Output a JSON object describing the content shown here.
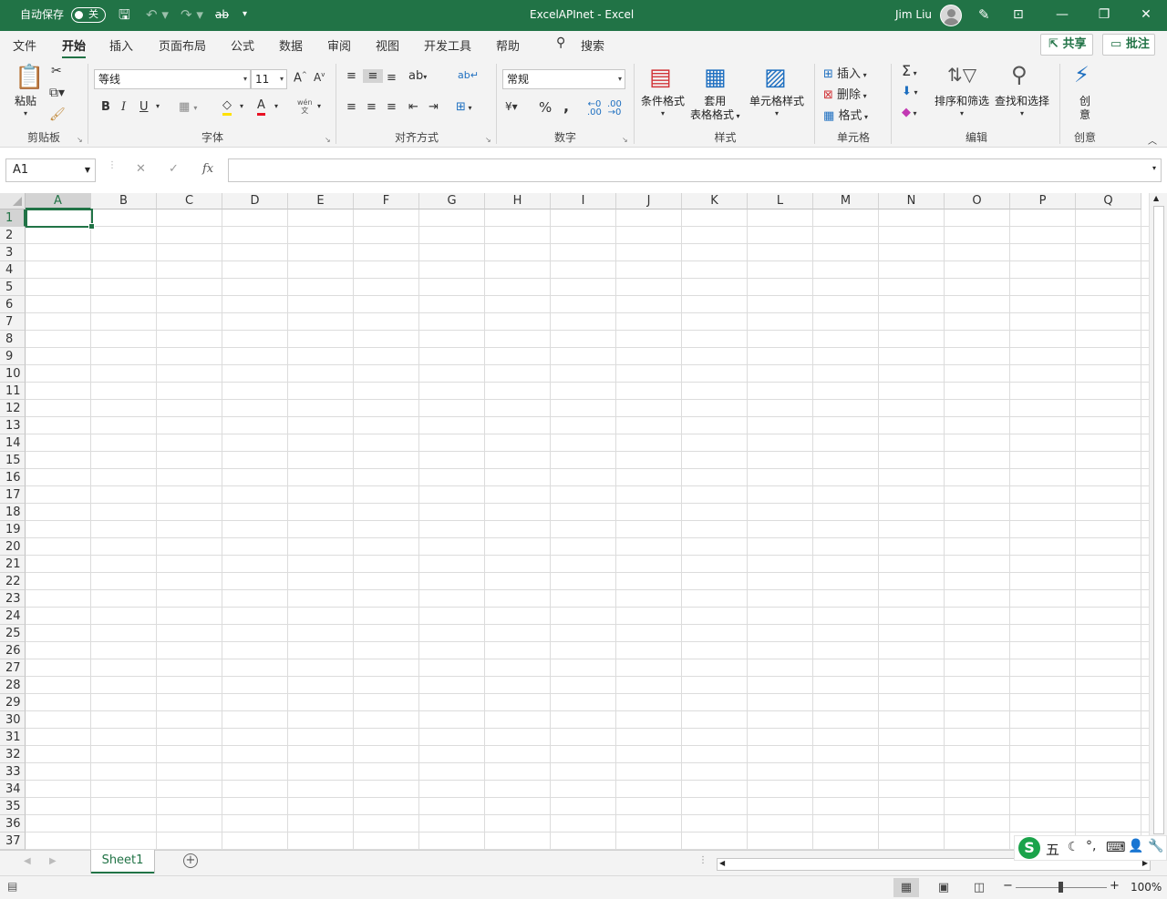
{
  "titlebar": {
    "autosave_label": "自动保存",
    "autosave_state": "关",
    "title": "ExcelAPInet  -  Excel",
    "user": "Jim Liu"
  },
  "menu": {
    "tabs": [
      "文件",
      "开始",
      "插入",
      "页面布局",
      "公式",
      "数据",
      "审阅",
      "视图",
      "开发工具",
      "帮助"
    ],
    "active_tab": "开始",
    "search": "搜索",
    "share": "共享",
    "comments": "批注"
  },
  "ribbon": {
    "clipboard": {
      "label": "剪贴板",
      "paste": "粘贴"
    },
    "font": {
      "label": "字体",
      "font_name": "等线",
      "font_size": "11",
      "bold": "B",
      "italic": "I",
      "underline": "U",
      "phonetic": "wén"
    },
    "alignment": {
      "label": "对齐方式"
    },
    "number": {
      "label": "数字",
      "format": "常规"
    },
    "styles": {
      "label": "样式",
      "conditional": "条件格式",
      "table_line1": "套用",
      "table_line2": "表格格式",
      "cell_styles": "单元格样式"
    },
    "cells": {
      "label": "单元格",
      "insert": "插入",
      "delete": "删除",
      "format": "格式"
    },
    "editing": {
      "label": "编辑",
      "sort_filter": "排序和筛选",
      "find_select": "查找和选择"
    },
    "ideas": {
      "label": "创意",
      "line1": "创",
      "line2": "意"
    }
  },
  "formula_bar": {
    "name_box": "A1",
    "fx": "fx",
    "formula": ""
  },
  "sheet": {
    "columns": [
      "A",
      "B",
      "C",
      "D",
      "E",
      "F",
      "G",
      "H",
      "I",
      "J",
      "K",
      "L",
      "M",
      "N",
      "O",
      "P",
      "Q"
    ],
    "rows": [
      "1",
      "2",
      "3",
      "4",
      "5",
      "6",
      "7",
      "8",
      "9",
      "10",
      "11",
      "12",
      "13",
      "14",
      "15",
      "16",
      "17",
      "18",
      "19",
      "20",
      "21",
      "22",
      "23",
      "24",
      "25",
      "26",
      "27",
      "28",
      "29",
      "30",
      "31",
      "32",
      "33",
      "34",
      "35",
      "36",
      "37"
    ],
    "selected_cell": "A1",
    "tabs": [
      "Sheet1"
    ]
  },
  "ime": {
    "mode": "五"
  },
  "status": {
    "zoom": "100%"
  },
  "colors": {
    "accent": "#217346",
    "ribbon_bg": "#f3f3f3",
    "grid_line": "#dcdcdc"
  }
}
